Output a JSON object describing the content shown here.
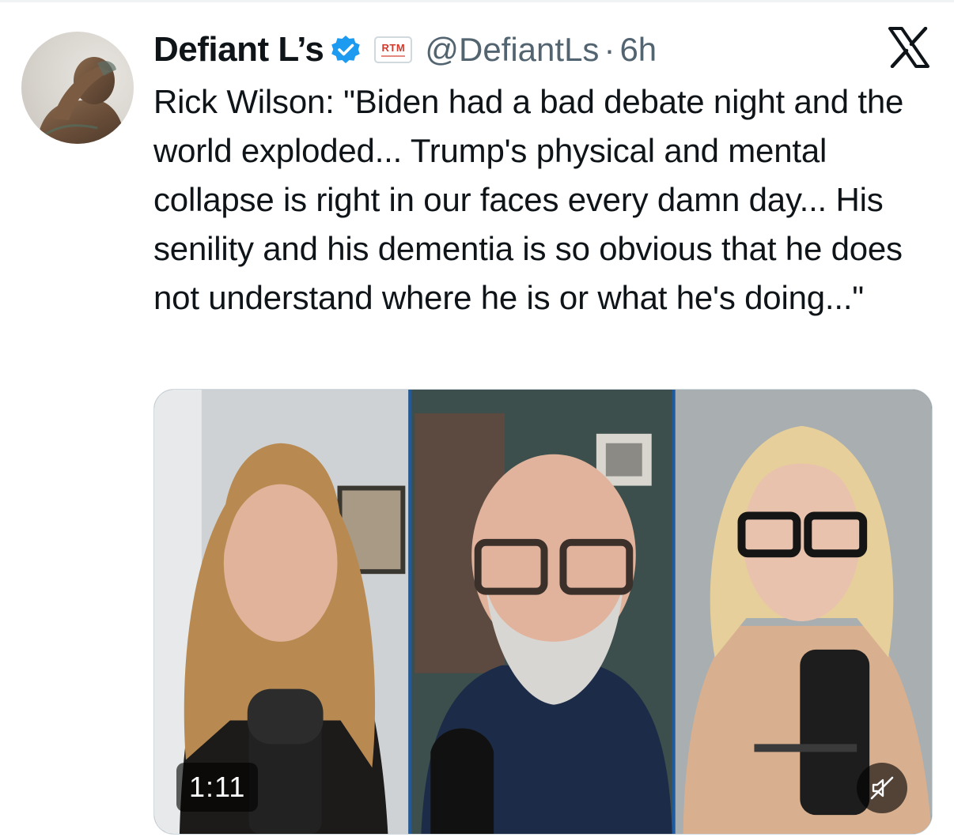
{
  "tweet": {
    "author_name": "Defiant L’s",
    "verified_icon": "verified-badge-icon",
    "affiliate_badge": "RTM",
    "handle": "@DefiantLs",
    "separator": "·",
    "time": "6h",
    "text": "Rick Wilson: \"Biden had a bad debate night and the world exploded... Trump's physical and mental collapse is right in our faces every damn day... His senility and his dementia is so obvious that he does not understand where he is or what he's doing...\""
  },
  "video": {
    "duration": "1:11",
    "mute_icon": "muted-speaker-icon"
  },
  "colors": {
    "text": "#0f1419",
    "secondary": "#536471",
    "verified": "#1d9bf0",
    "affiliate_red": "#d13a2c"
  }
}
